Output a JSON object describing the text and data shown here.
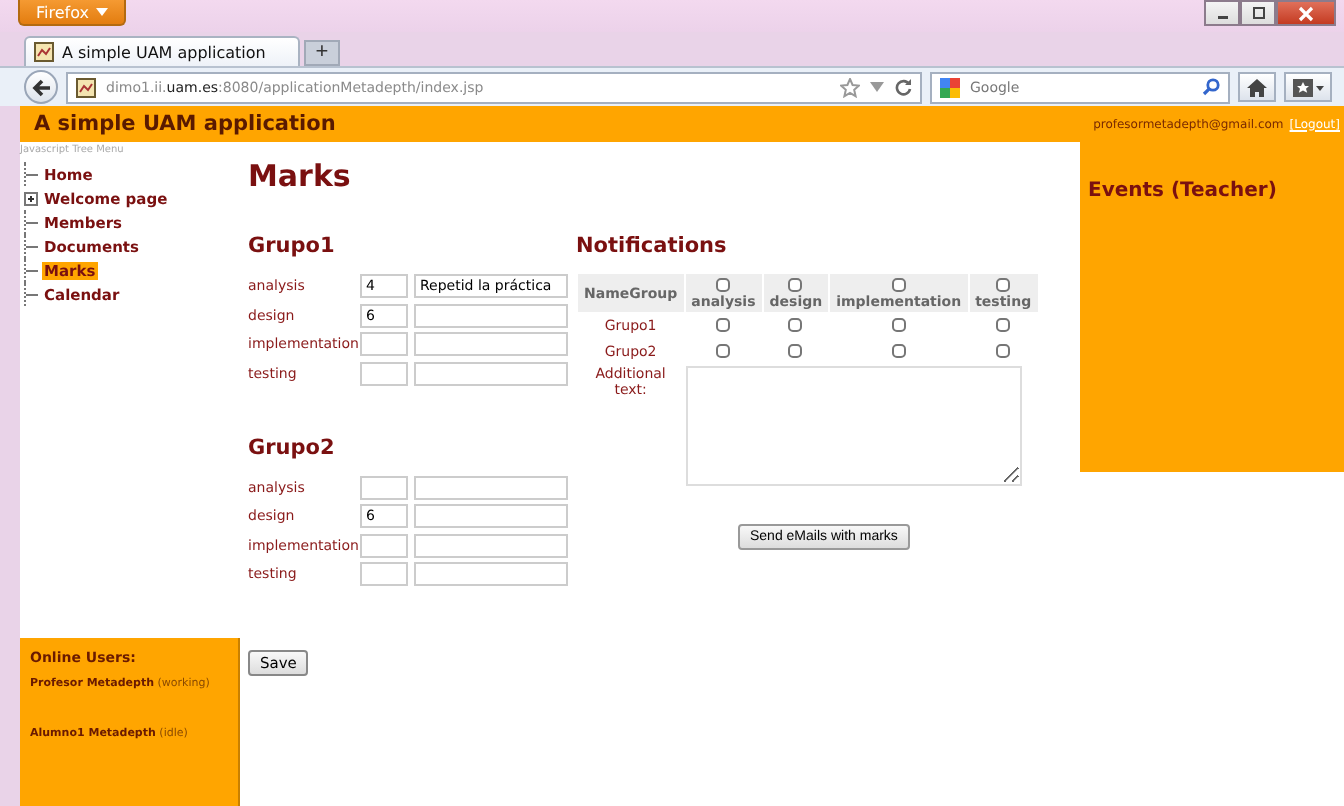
{
  "browser": {
    "menu_button": "Firefox",
    "tab_title": "A simple UAM application",
    "new_tab": "+",
    "url": "dimo1.ii.**uam.es**:8080/applicationMetadepth/index.jsp",
    "search_placeholder": "Google"
  },
  "header": {
    "title": "A simple UAM application",
    "user_email": "profesormetadepth@gmail.com",
    "logout": "[Logout]"
  },
  "tree_menu": {
    "caption": "Javascript Tree Menu",
    "items": [
      {
        "label": "Home",
        "kind": "leaf",
        "selected": false
      },
      {
        "label": "Welcome page",
        "kind": "folder",
        "expanded": false,
        "selected": false
      },
      {
        "label": "Members",
        "kind": "leaf",
        "selected": false
      },
      {
        "label": "Documents",
        "kind": "leaf",
        "selected": false
      },
      {
        "label": "Marks",
        "kind": "leaf",
        "selected": true
      },
      {
        "label": "Calendar",
        "kind": "leaf",
        "selected": false
      }
    ]
  },
  "online_users": {
    "title": "Online Users:",
    "users": [
      {
        "name": "Profesor Metadepth",
        "status": "(working)"
      },
      {
        "name": "Alumno1 Metadepth",
        "status": "(idle)"
      }
    ]
  },
  "page_title": "Marks",
  "groups": [
    {
      "name": "Grupo1",
      "marks": [
        {
          "criterion": "analysis",
          "score": "4",
          "comment": "Repetid la práctica"
        },
        {
          "criterion": "design",
          "score": "6"
        },
        {
          "criterion": "implementation"
        },
        {
          "criterion": "testing"
        }
      ]
    },
    {
      "name": "Grupo2",
      "marks": [
        {
          "criterion": "analysis"
        },
        {
          "criterion": "design",
          "score": "6"
        },
        {
          "criterion": "implementation"
        },
        {
          "criterion": "testing"
        }
      ]
    }
  ],
  "save_button": "Save",
  "notifications": {
    "title": "Notifications",
    "name_column": "NameGroup",
    "columns": [
      {
        "label": "analysis",
        "checked": false
      },
      {
        "label": "design",
        "checked": false
      },
      {
        "label": "implementation",
        "checked": false
      },
      {
        "label": "testing",
        "checked": false
      }
    ],
    "rows": [
      {
        "group": "Grupo1",
        "checks": [
          {
            "checked": false
          },
          {
            "checked": false
          },
          {
            "checked": false
          },
          {
            "checked": false
          }
        ]
      },
      {
        "group": "Grupo2",
        "checks": [
          {
            "checked": false
          },
          {
            "checked": false
          },
          {
            "checked": false
          },
          {
            "checked": false
          }
        ]
      }
    ],
    "additional_text_label": "Additional text:",
    "send_button": "Send eMails with marks"
  },
  "events": {
    "title": "Events (Teacher)"
  }
}
